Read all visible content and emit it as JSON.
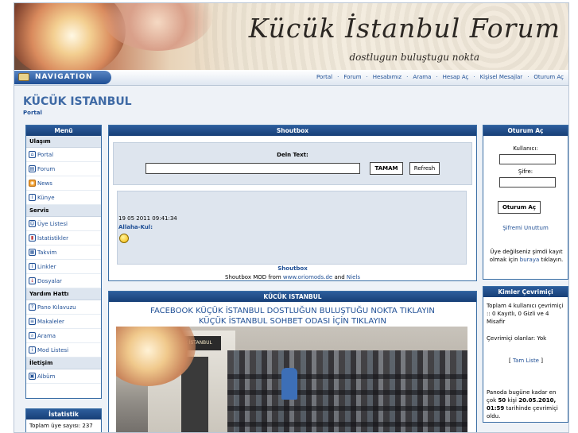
{
  "banner": {
    "title": "Kücük İstanbul Forum",
    "subtitle": "dostlugun buluştugu nokta"
  },
  "nav": {
    "badge": "NAVIGATION",
    "links": [
      "Portal",
      "Forum",
      "Hesabımız",
      "Arama",
      "Hesap Aç",
      "Kişisel Mesajlar",
      "Oturum Aç"
    ]
  },
  "site": {
    "title": "KÜCÜK ISTANBUL",
    "crumb": "Portal"
  },
  "menu": {
    "title": "Menü",
    "sections": [
      {
        "label": "Ulaşım",
        "items": [
          "Portal",
          "Forum",
          "News",
          "Künye"
        ]
      },
      {
        "label": "Servis",
        "items": [
          "Üye Listesi",
          "İstatistikler",
          "Takvim",
          "Linkler",
          "Dosyalar"
        ]
      },
      {
        "label": "Yardım Hattı",
        "items": [
          "Pano Kılavuzu",
          "Makaleler",
          "Arama",
          "Mod Listesi"
        ]
      },
      {
        "label": "İletişim",
        "items": [
          "Albüm"
        ]
      }
    ]
  },
  "stats": {
    "title": "İstatistik",
    "line": "Toplam üye sayısı: 237"
  },
  "shoutbox": {
    "title": "Shoutbox",
    "input_label": "Deln Text:",
    "submit": "TAMAM",
    "refresh": "Refresh",
    "message": {
      "date": "19 05 2011 09:41:34",
      "user": "Allaha-Kul:"
    },
    "footer_label": "Shoutbox",
    "credit_prefix": "Shoutbox MOD from",
    "credit_site": "www.oriomods.de",
    "credit_and": "and",
    "credit_author": "Niels"
  },
  "kucuk": {
    "title": "KÜCÜK ISTANBUL",
    "line1": "FACEBOOK KÜÇÜK İSTANBUL DOSTLUĞUN BULUŞTUĞU NOKTA TIKLAYIN",
    "line2": "KÜÇÜK İSTANBUL SOHBET ODASI İÇİN TIKLAYIN",
    "photo_sign": "KÜÇÜK İSTANBUL PAVYON"
  },
  "login": {
    "title": "Oturum Aç",
    "user_label": "Kullanıcı:",
    "pass_label": "Şifre:",
    "button": "Oturum Aç",
    "forgot": "Şifremi Unuttum",
    "reg_text1": "Üye değilseniz şimdi kayıt olmak için",
    "reg_link": "buraya",
    "reg_text2": "tıklayın."
  },
  "online": {
    "title": "Kimler Çevrimiçi",
    "p1": "Toplam 4 kullanıcı çevrimiçi :: 0 Kayıtlı, 0 Gizli ve 4 Misafir",
    "p2": "Çevrimiçi olanlar: Yok",
    "full_list_open": "[",
    "full_list": "Tam Liste",
    "full_list_close": "]",
    "p3a": "Panoda bugüne kadar en çok",
    "p3b": "50",
    "p3c": "kişi",
    "p3d": "20.05.2010, 01:59",
    "p3e": "tarihinde çevrimiçi oldu."
  }
}
